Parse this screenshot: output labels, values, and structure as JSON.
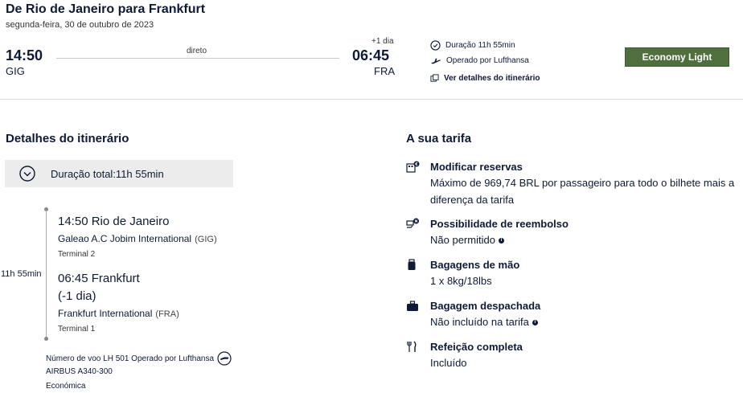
{
  "header": {
    "title": "De Rio de Janeiro para Frankfurt",
    "date": "segunda-feira, 30 de outubro de 2023"
  },
  "flight": {
    "departure_time": "14:50",
    "departure_code": "GIG",
    "arrival_time": "06:45",
    "arrival_code": "FRA",
    "day_offset": "+1 dia",
    "stops_label": "direto",
    "duration": "Duração 11h 55min",
    "operator": "Operado por Lufthansa",
    "details_link": "Ver detalhes do itinerário",
    "fare_button": "Economy Light"
  },
  "itinerary": {
    "title": "Detalhes do itinerário",
    "total_duration": "Duração total:11h 55min",
    "segment_duration": "11h 55min",
    "origin": {
      "time_city": "14:50 Rio de Janeiro",
      "airport": "Galeao A.C Jobim International",
      "airport_code": "(GIG)",
      "terminal": "Terminal 2"
    },
    "destination": {
      "time_city": "06:45 Frankfurt",
      "day_note": "(-1 dia)",
      "airport": "Frankfurt International",
      "airport_code": "(FRA)",
      "terminal": "Terminal 1"
    },
    "flight_number": "Número de voo LH 501 Operado por Lufthansa",
    "aircraft": "AIRBUS A340-300",
    "cabin": "Económica"
  },
  "fare": {
    "title": "A sua tarifa",
    "items": [
      {
        "icon": "change-booking-icon",
        "title": "Modificar reservas",
        "text": "Máximo de 969,74 BRL por passageiro para todo o bilhete mais a diferença da tarifa"
      },
      {
        "icon": "refund-icon",
        "title": "Possibilidade de reembolso",
        "text": "Não permitido"
      },
      {
        "icon": "carry-on-bag-icon",
        "title": "Bagagens de mão",
        "text": "1 x 8kg/18lbs"
      },
      {
        "icon": "checked-bag-icon",
        "title": "Bagagem despachada",
        "text": "Não incluído na tarifa"
      },
      {
        "icon": "meal-icon",
        "title": "Refeição completa",
        "text": "Incluído"
      }
    ]
  },
  "colors": {
    "text": "#0e1a36",
    "fare_button_bg": "#4f6f3f",
    "duration_box_bg": "#ececec",
    "divider": "#dcdcdc"
  }
}
